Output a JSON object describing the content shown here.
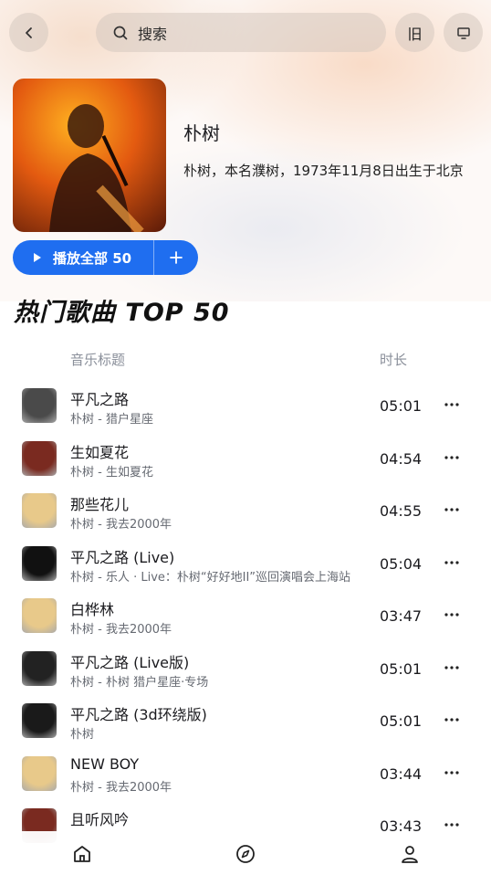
{
  "header": {
    "search_placeholder": "搜索",
    "mode_button_label": "旧",
    "icons": {
      "back": "chevron-left-icon",
      "search": "search-icon",
      "screen": "monitor-icon"
    }
  },
  "artist": {
    "name": "朴树",
    "description": "朴树，本名濮树，1973年11月8日出生于北京"
  },
  "actions": {
    "play_all_label": "播放全部 50",
    "add_icon": "plus-icon",
    "play_icon": "play-icon"
  },
  "section": {
    "title": "热门歌曲 TOP 50",
    "col_title": "音乐标题",
    "col_duration": "时长"
  },
  "songs": [
    {
      "title": "平凡之路",
      "subtitle": "朴树 - 猎户星座",
      "duration": "05:01",
      "thumb_color": "#4a4a4a"
    },
    {
      "title": "生如夏花",
      "subtitle": "朴树 - 生如夏花",
      "duration": "04:54",
      "thumb_color": "#7a2a20"
    },
    {
      "title": "那些花儿",
      "subtitle": "朴树 - 我去2000年",
      "duration": "04:55",
      "thumb_color": "#e8c98a"
    },
    {
      "title": "平凡之路 (Live)",
      "subtitle": "朴树 - 乐人 · Live：朴树“好好地II”巡回演唱会上海站",
      "duration": "05:04",
      "thumb_color": "#111111"
    },
    {
      "title": "白桦林",
      "subtitle": "朴树 - 我去2000年",
      "duration": "03:47",
      "thumb_color": "#e8c98a"
    },
    {
      "title": "平凡之路 (Live版)",
      "subtitle": "朴树 - 朴树 猎户星座·专场",
      "duration": "05:01",
      "thumb_color": "#222222"
    },
    {
      "title": "平凡之路 (3d环绕版)",
      "subtitle": "朴树",
      "duration": "05:01",
      "thumb_color": "#1a1a1a"
    },
    {
      "title": "NEW BOY",
      "subtitle": "朴树 - 我去2000年",
      "duration": "03:44",
      "thumb_color": "#e8c98a"
    },
    {
      "title": "且听风吟",
      "subtitle": "",
      "duration": "03:43",
      "thumb_color": "#7a2a20"
    }
  ],
  "bottom_nav": [
    {
      "name": "home",
      "icon": "home-icon"
    },
    {
      "name": "discover",
      "icon": "compass-icon"
    },
    {
      "name": "profile",
      "icon": "user-icon"
    }
  ],
  "colors": {
    "accent": "#1f6ef0",
    "muted_text": "#8a8f9a"
  }
}
